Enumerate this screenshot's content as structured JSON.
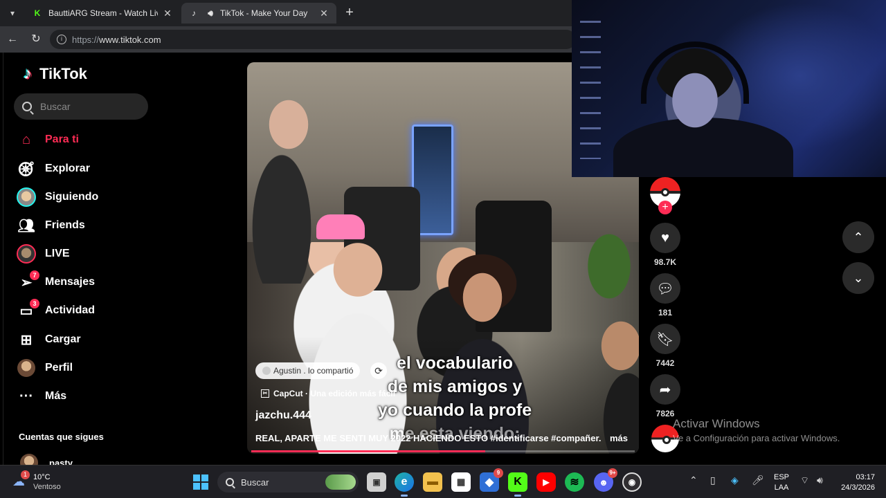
{
  "browser": {
    "tabs": [
      {
        "title": "BauttiARG Stream - Watch Live on",
        "favicon": "kick-icon",
        "active": false
      },
      {
        "title": "TikTok - Make Your Day",
        "favicon": "tiktok-icon",
        "active": true,
        "audio": true
      }
    ],
    "url_protocol": "https://",
    "url_host": "www.tiktok.com"
  },
  "sidebar": {
    "logo": "TikTok",
    "search_placeholder": "Buscar",
    "items": [
      {
        "label": "Para ti",
        "icon": "home-icon",
        "active": true
      },
      {
        "label": "Explorar",
        "icon": "compass-icon"
      },
      {
        "label": "Siguiendo",
        "icon": "following-avatar"
      },
      {
        "label": "Friends",
        "icon": "friends-icon"
      },
      {
        "label": "LIVE",
        "icon": "live-avatar"
      },
      {
        "label": "Mensajes",
        "icon": "send-icon",
        "badge": "7"
      },
      {
        "label": "Actividad",
        "icon": "message-icon",
        "badge": "3"
      },
      {
        "label": "Cargar",
        "icon": "plus-square-icon"
      },
      {
        "label": "Perfil",
        "icon": "profile-avatar"
      },
      {
        "label": "Más",
        "icon": "more-icon"
      }
    ],
    "following_title": "Cuentas que sigues",
    "following": [
      {
        "name": "pasty"
      }
    ]
  },
  "video": {
    "caption_lines": [
      "el vocabulario",
      "de mis amigos y",
      "yo cuando la profe",
      "me esta viendo:"
    ],
    "shared_by": "Agustin . lo compartió",
    "capcut": "CapCut · Una edición más fácil",
    "username": "jazchu.444",
    "description": "REAL, APARTE ME SENTI MUY 2022 HACIENDO ESTO #identificarse #compañer...",
    "more": "más",
    "progress": 0.61
  },
  "actions": {
    "likes": "98.7K",
    "comments": "181",
    "saves": "7442",
    "shares": "7826"
  },
  "watermark": {
    "title": "Activar Windows",
    "subtitle": "Ve a Configuración para activar Windows."
  },
  "taskbar": {
    "weather_temp": "10°C",
    "weather_desc": "Ventoso",
    "weather_badge": "1",
    "search_label": "Buscar",
    "apps": [
      {
        "name": "file-explorer-window",
        "badge": ""
      },
      {
        "name": "edge",
        "badge": ""
      },
      {
        "name": "folder",
        "badge": ""
      },
      {
        "name": "store",
        "badge": ""
      },
      {
        "name": "app-9",
        "badge": "9"
      },
      {
        "name": "kick",
        "badge": ""
      },
      {
        "name": "youtube",
        "badge": ""
      },
      {
        "name": "spotify",
        "badge": ""
      },
      {
        "name": "discord",
        "badge": "9+"
      },
      {
        "name": "obs",
        "badge": ""
      }
    ],
    "language_line1": "ESP",
    "language_line2": "LAA",
    "time": "03:17",
    "date": "24/3/2026"
  },
  "colors": {
    "accent": "#fe2c55",
    "tiktok_cyan": "#25f4ee",
    "page_bg": "#000000"
  }
}
